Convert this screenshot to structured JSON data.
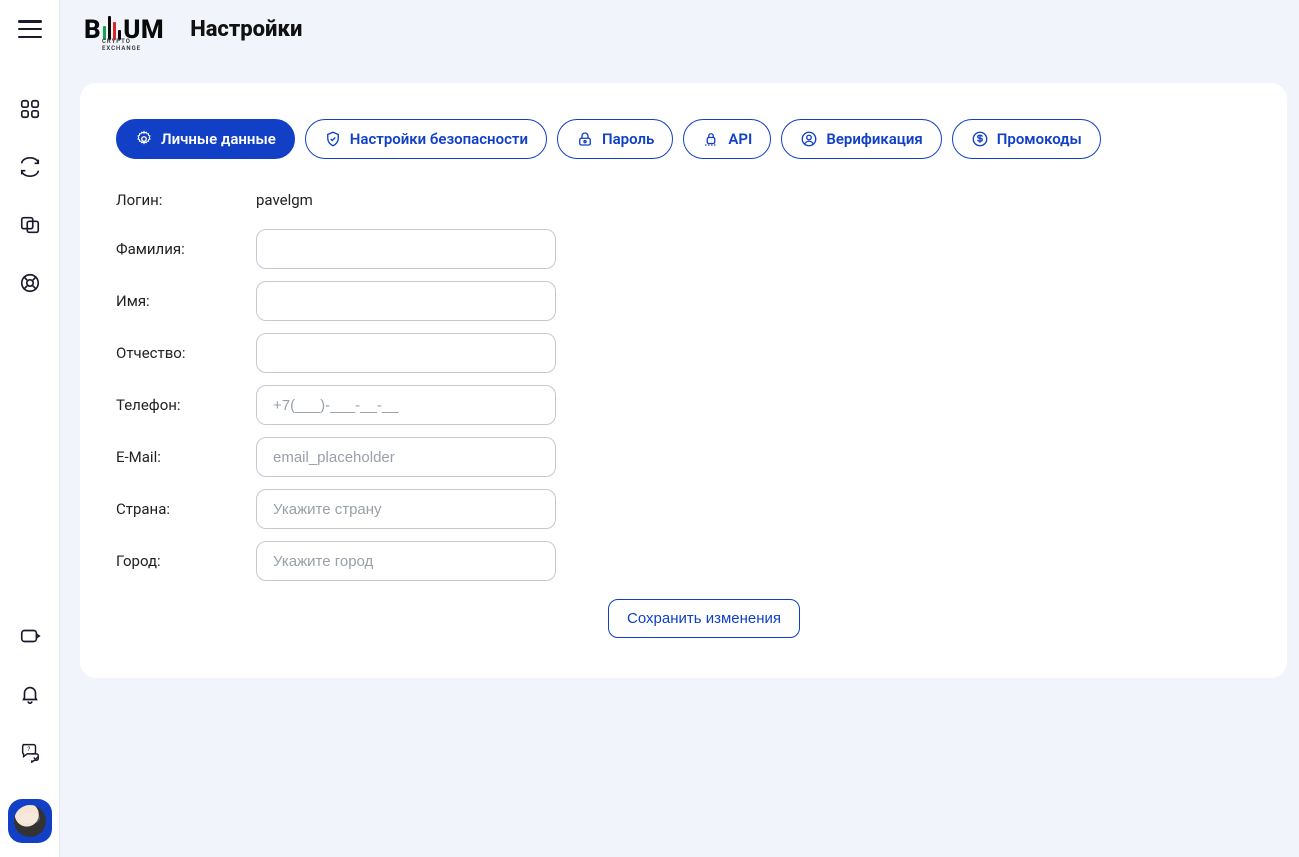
{
  "header": {
    "logo_text_left": "B",
    "logo_text_right": "UM",
    "logo_subtitle": "CRYPTO EXCHANGE",
    "page_title": "Настройки"
  },
  "tabs": [
    {
      "id": "personal",
      "label": "Личные данные",
      "icon": "settings-icon",
      "active": true
    },
    {
      "id": "security",
      "label": "Настройки безопасности",
      "icon": "shield-check-icon",
      "active": false
    },
    {
      "id": "password",
      "label": "Пароль",
      "icon": "lock-key-icon",
      "active": false
    },
    {
      "id": "api",
      "label": "API",
      "icon": "api-lock-icon",
      "active": false
    },
    {
      "id": "verify",
      "label": "Верификация",
      "icon": "user-circle-icon",
      "active": false
    },
    {
      "id": "promo",
      "label": "Промокоды",
      "icon": "dollar-circle-icon",
      "active": false
    }
  ],
  "form": {
    "login_label": "Логин:",
    "login_value": "pavelgm",
    "lastname_label": "Фамилия:",
    "lastname_value": "",
    "firstname_label": "Имя:",
    "firstname_value": "",
    "patronymic_label": "Отчество:",
    "patronymic_value": "",
    "phone_label": "Телефон:",
    "phone_value": "",
    "phone_placeholder": "+7(___)-___-__-__",
    "email_label": "E-Mail:",
    "email_value": "",
    "email_placeholder": "email_placeholder",
    "country_label": "Страна:",
    "country_value": "",
    "country_placeholder": "Укажите страну",
    "city_label": "Город:",
    "city_value": "",
    "city_placeholder": "Укажите город",
    "save_button": "Сохранить изменения"
  },
  "sidebar": {
    "top_items": [
      {
        "name": "dashboard-icon"
      },
      {
        "name": "exchange-icon"
      },
      {
        "name": "transfer-icon"
      },
      {
        "name": "support-icon"
      }
    ],
    "bottom_items": [
      {
        "name": "wallet-out-icon"
      },
      {
        "name": "bell-icon"
      },
      {
        "name": "chat-help-icon"
      },
      {
        "name": "avatar"
      }
    ]
  }
}
